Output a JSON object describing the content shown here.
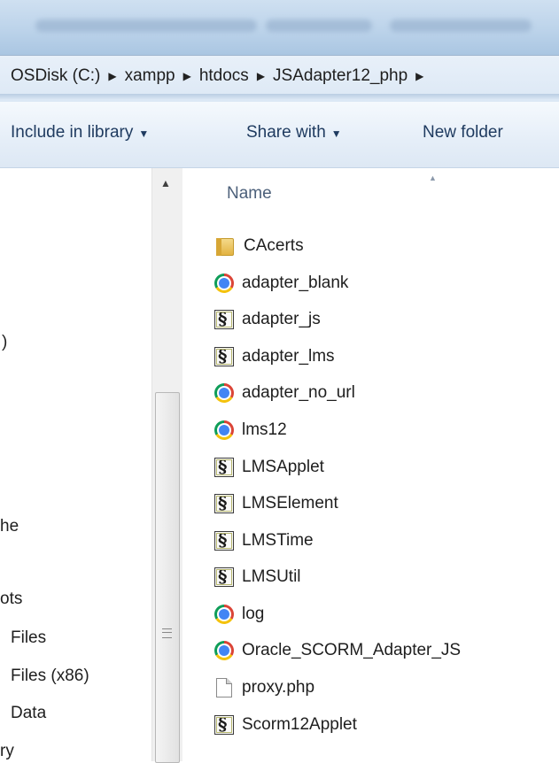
{
  "address": {
    "crumbs": [
      "OSDisk (C:)",
      "xampp",
      "htdocs",
      "JSAdapter12_php"
    ]
  },
  "commandbar": {
    "include_label": "Include in library",
    "share_label": "Share with",
    "newfolder_label": "New folder"
  },
  "nav": {
    "items": [
      ")",
      "he",
      "ots",
      "Files",
      "Files (x86)",
      "Data",
      "ry"
    ]
  },
  "filelist": {
    "column_name": "Name",
    "items": [
      {
        "name": "CAcerts",
        "icon": "folder-icon"
      },
      {
        "name": "adapter_blank",
        "icon": "chrome-icon"
      },
      {
        "name": "adapter_js",
        "icon": "script-icon"
      },
      {
        "name": "adapter_lms",
        "icon": "script-icon"
      },
      {
        "name": "adapter_no_url",
        "icon": "chrome-icon"
      },
      {
        "name": "lms12",
        "icon": "chrome-icon"
      },
      {
        "name": "LMSApplet",
        "icon": "script-icon"
      },
      {
        "name": "LMSElement",
        "icon": "script-icon"
      },
      {
        "name": "LMSTime",
        "icon": "script-icon"
      },
      {
        "name": "LMSUtil",
        "icon": "script-icon"
      },
      {
        "name": "log",
        "icon": "chrome-icon"
      },
      {
        "name": "Oracle_SCORM_Adapter_JS",
        "icon": "chrome-icon"
      },
      {
        "name": "proxy.php",
        "icon": "file-icon"
      },
      {
        "name": "Scorm12Applet",
        "icon": "script-icon"
      }
    ]
  },
  "colors": {
    "command_text": "#1e3a5f",
    "header_text": "#4c607a"
  }
}
